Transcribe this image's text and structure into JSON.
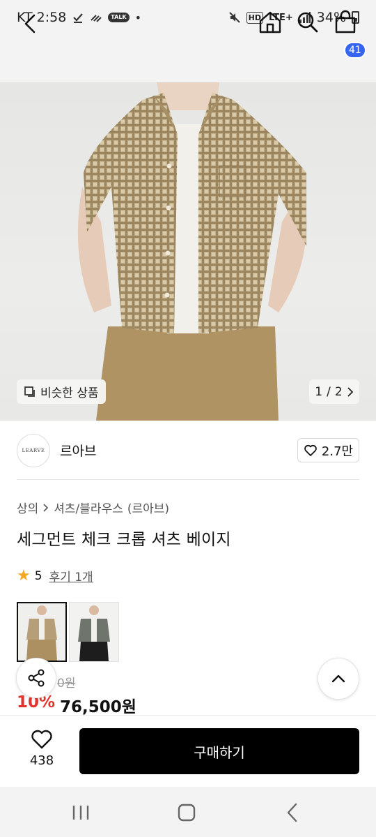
{
  "status_bar": {
    "carrier_time": "KT 2:58",
    "talk_label": "TALK",
    "dot": "•",
    "hd_label": "HD",
    "network": "LTE+",
    "battery": "34%"
  },
  "header": {
    "cart_count": "41"
  },
  "gallery": {
    "similar_label": "비슷한 상품",
    "pager_current": "1",
    "pager_sep": "/",
    "pager_total": "2"
  },
  "brand": {
    "logo_text": "LEARVE",
    "name": "르아브",
    "like_count": "2.7만"
  },
  "breadcrumb": {
    "items": [
      "상의",
      "셔츠/블라우스",
      "(르아브)"
    ]
  },
  "product": {
    "title": "세그먼트 체크 크롭 셔츠 베이지",
    "rating": "5",
    "review_text": "후기 1개",
    "original_price_partial": "0원",
    "discount": "10%",
    "price": "76,500원"
  },
  "colors": {
    "beige_check": "#b69f78",
    "gray_green": "#6f756c",
    "discount_red": "#e2342c",
    "badge_blue": "#3564f0",
    "star_yellow": "#f5a623"
  },
  "actions": {
    "wish_count": "438",
    "buy_label": "구매하기"
  },
  "icons": {
    "back": "chevron-left-icon",
    "home": "home-icon",
    "search": "search-icon",
    "bag": "shopping-bag-icon",
    "share": "share-icon",
    "top": "chevron-up-icon",
    "heart": "heart-icon"
  }
}
